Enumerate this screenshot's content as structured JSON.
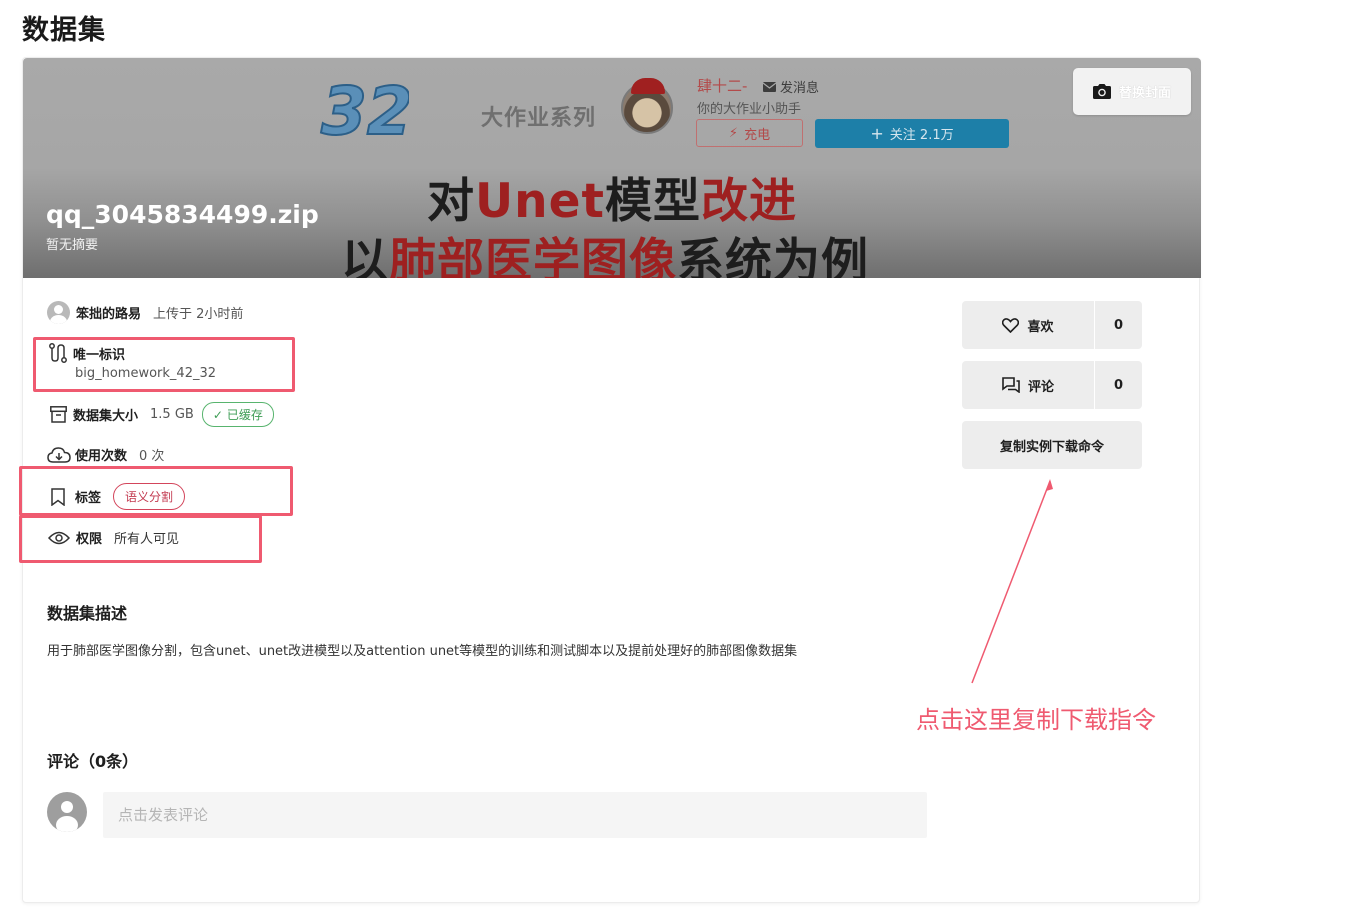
{
  "page": {
    "title": "数据集"
  },
  "banner": {
    "series_text": "大作业系列",
    "logo_text": "32",
    "username": "肆十二-",
    "message_label": "发消息",
    "subtitle": "你的大作业小助手",
    "charge_label": "充电",
    "follow_label": "关注 2.1万",
    "headline1_a": "对",
    "headline1_b": "Unet",
    "headline1_c": "模型",
    "headline1_d": "改进",
    "headline2_a": "以",
    "headline2_b": "肺部医学图像",
    "headline2_c": "系统为例",
    "cover_button_label": "替换封面",
    "file_title": "qq_3045834499.zip",
    "file_summary": "暂无摘要"
  },
  "info": {
    "uploader": {
      "name": "笨拙的路易",
      "time": "上传于 2小时前"
    },
    "unique_id": {
      "label": "唯一标识",
      "value": "big_homework_42_32"
    },
    "size": {
      "label": "数据集大小",
      "value": "1.5 GB",
      "badge": "已缓存"
    },
    "usage": {
      "label": "使用次数",
      "value": "0 次"
    },
    "tags": {
      "label": "标签",
      "tag": "语义分割"
    },
    "permission": {
      "label": "权限",
      "value": "所有人可见"
    }
  },
  "actions": {
    "like": {
      "label": "喜欢",
      "count": "0"
    },
    "comment": {
      "label": "评论",
      "count": "0"
    },
    "copy_command_label": "复制实例下载命令"
  },
  "annotation": {
    "text": "点击这里复制下载指令"
  },
  "description": {
    "title": "数据集描述",
    "text": "用于肺部医学图像分割，包含unet、unet改进模型以及attention unet等模型的训练和测试脚本以及提前处理好的肺部图像数据集"
  },
  "comments": {
    "title": "评论（0条）",
    "placeholder": "点击发表评论"
  },
  "colors": {
    "highlight": "#ef5a70",
    "cached_badge": "#3e9d55",
    "tag_badge": "#c33a50",
    "follow_button": "#1d7fa8"
  }
}
